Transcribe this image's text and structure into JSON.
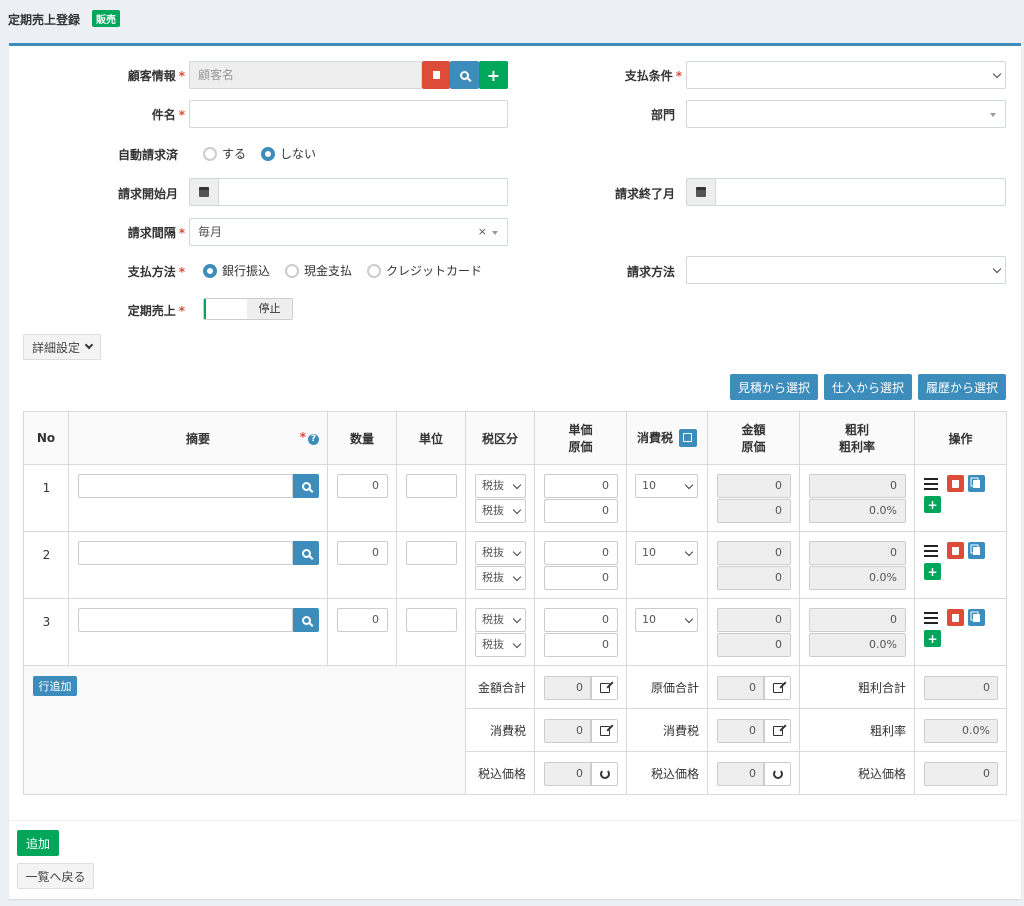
{
  "header": {
    "title": "定期売上登録",
    "badge": "販売"
  },
  "form": {
    "customer": {
      "label": "顧客情報",
      "placeholder": "顧客名"
    },
    "subject": {
      "label": "件名"
    },
    "auto_billed": {
      "label": "自動請求済",
      "options": [
        "する",
        "しない"
      ],
      "selected": "しない"
    },
    "billing_start": {
      "label": "請求開始月"
    },
    "billing_interval": {
      "label": "請求間隔",
      "value": "毎月"
    },
    "payment_method": {
      "label": "支払方法",
      "options": [
        "銀行振込",
        "現金支払",
        "クレジットカード"
      ],
      "selected": "銀行振込"
    },
    "recurring": {
      "label": "定期売上",
      "toggle_label": "停止"
    },
    "payment_terms": {
      "label": "支払条件"
    },
    "department": {
      "label": "部門"
    },
    "billing_end": {
      "label": "請求終了月"
    },
    "billing_method": {
      "label": "請求方法"
    },
    "required_mark": "*",
    "clear_mark": "×"
  },
  "detail_button": "詳細設定",
  "select_buttons": [
    "見積から選択",
    "仕入から選択",
    "履歴から選択"
  ],
  "table": {
    "headers": {
      "no": "No",
      "summary": "摘要",
      "qty": "数量",
      "unit": "単位",
      "tax_class": "税区分",
      "price_1": "単価",
      "price_2": "原価",
      "tax": "消費税",
      "amount_1": "金額",
      "amount_2": "原価",
      "profit_1": "粗利",
      "profit_2": "粗利率",
      "ops": "操作"
    },
    "help_mark": "?",
    "rows": [
      {
        "no": "1",
        "qty": "0",
        "tax_class_1": "税抜",
        "tax_class_2": "税抜",
        "price": "0",
        "cost": "0",
        "tax": "10",
        "amount": "0",
        "amount_cost": "0",
        "profit": "0",
        "profit_rate": "0.0%"
      },
      {
        "no": "2",
        "qty": "0",
        "tax_class_1": "税抜",
        "tax_class_2": "税抜",
        "price": "0",
        "cost": "0",
        "tax": "10",
        "amount": "0",
        "amount_cost": "0",
        "profit": "0",
        "profit_rate": "0.0%"
      },
      {
        "no": "3",
        "qty": "0",
        "tax_class_1": "税抜",
        "tax_class_2": "税抜",
        "price": "0",
        "cost": "0",
        "tax": "10",
        "amount": "0",
        "amount_cost": "0",
        "profit": "0",
        "profit_rate": "0.0%"
      }
    ],
    "add_row": "行追加",
    "totals": {
      "amount_total": {
        "label": "金額合計",
        "value": "0"
      },
      "cost_total": {
        "label": "原価合計",
        "value": "0"
      },
      "profit_total": {
        "label": "粗利合計",
        "value": "0"
      },
      "tax_a": {
        "label": "消費税",
        "value": "0"
      },
      "tax_b": {
        "label": "消費税",
        "value": "0"
      },
      "profit_rate": {
        "label": "粗利率",
        "value": "0.0%"
      },
      "incl_a": {
        "label": "税込価格",
        "value": "0"
      },
      "incl_b": {
        "label": "税込価格",
        "value": "0"
      },
      "incl_c": {
        "label": "税込価格",
        "value": "0"
      }
    }
  },
  "footer": {
    "add": "追加",
    "back": "一覧へ戻る"
  }
}
